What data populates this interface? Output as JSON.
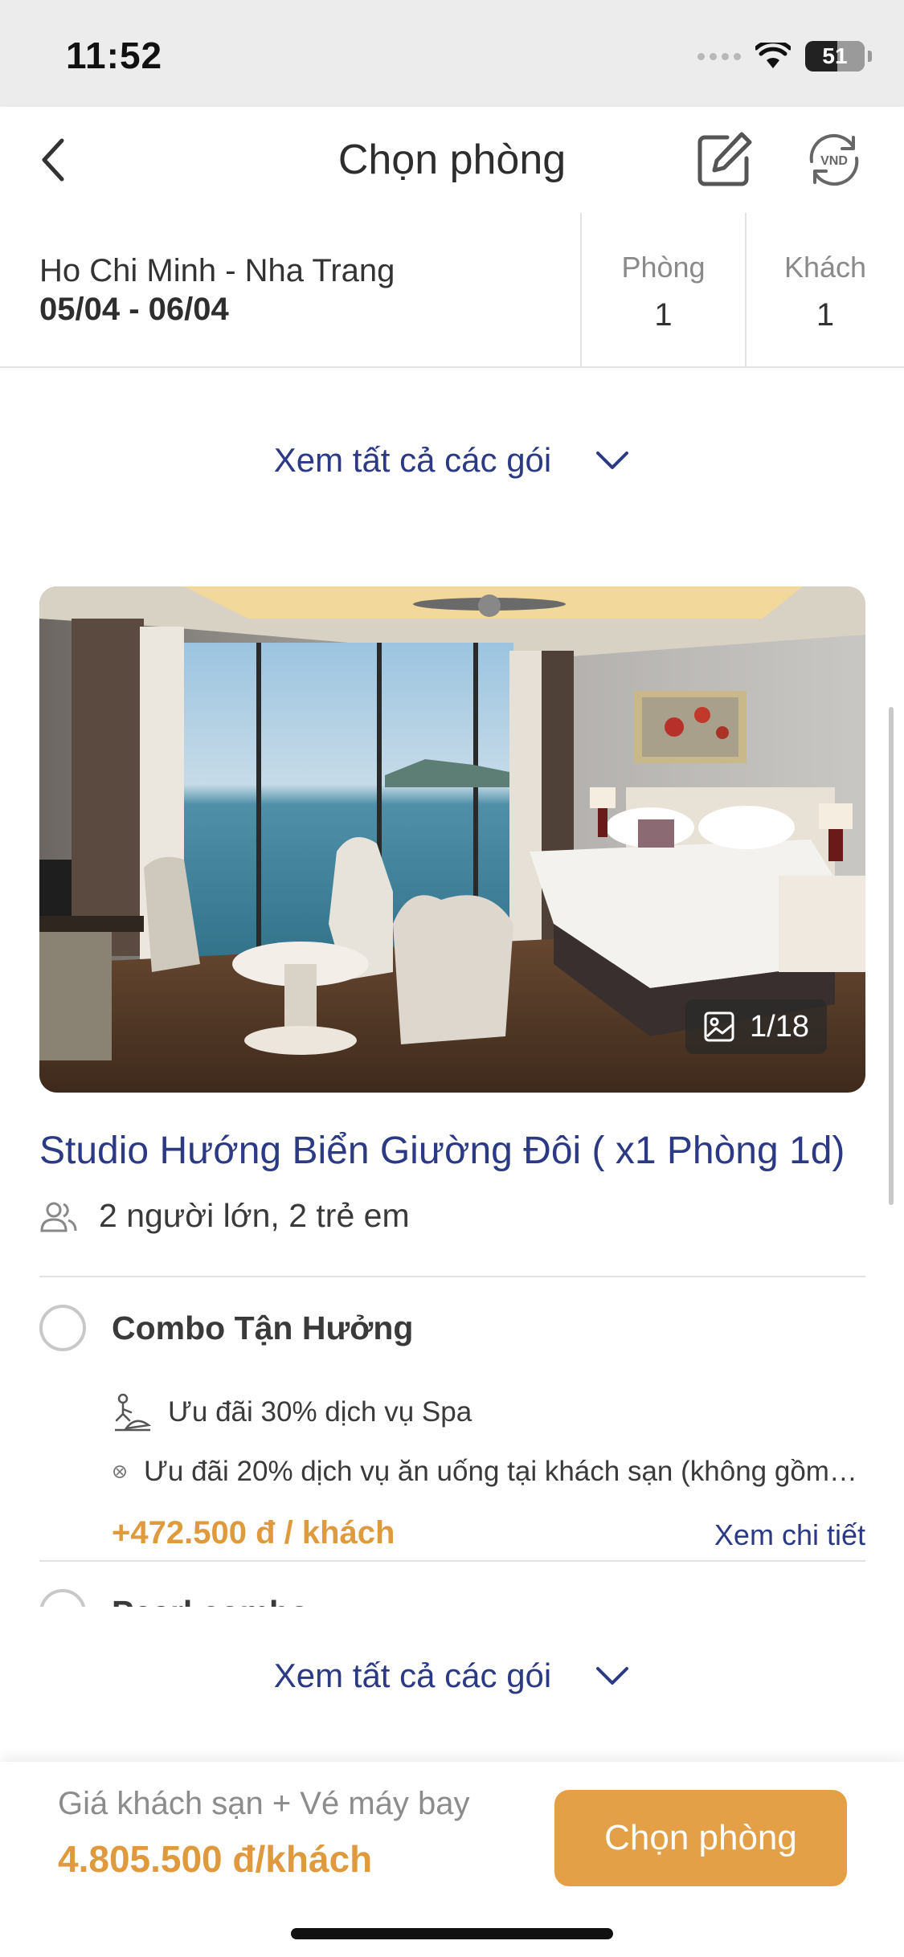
{
  "status_bar": {
    "time": "11:52",
    "battery": "51"
  },
  "header": {
    "title": "Chọn phòng",
    "currency_label": "VND"
  },
  "summary": {
    "route": "Ho Chi Minh - Nha Trang",
    "dates": "05/04 - 06/04",
    "rooms_label": "Phòng",
    "rooms_value": "1",
    "guests_label": "Khách",
    "guests_value": "1"
  },
  "see_all_label": "Xem tất cả các gói",
  "room": {
    "photo_counter": "1/18",
    "title": "Studio Hướng Biển Giường Đôi ( x1 Phòng 1d)",
    "occupancy": "2 người lớn, 2 trẻ em"
  },
  "packages": [
    {
      "name": "Combo Tận Hưởng",
      "perks": [
        {
          "icon": "spa-icon",
          "text": "Ưu đãi 30% dịch vụ Spa"
        },
        {
          "icon": "dining-icon",
          "text": "Ưu đãi 20% dịch vụ ăn uống tại khách sạn (không gồm…"
        }
      ],
      "price": "+472.500 đ / khách",
      "detail_link": "Xem chi tiết"
    },
    {
      "name": "Pearl combo"
    }
  ],
  "footer": {
    "price_label": "Giá khách sạn + Vé máy bay",
    "price_value": "4.805.500 đ/khách",
    "book_button": "Chọn phòng"
  },
  "colors": {
    "primary": "#2c3a86",
    "accent": "#e3a047"
  }
}
